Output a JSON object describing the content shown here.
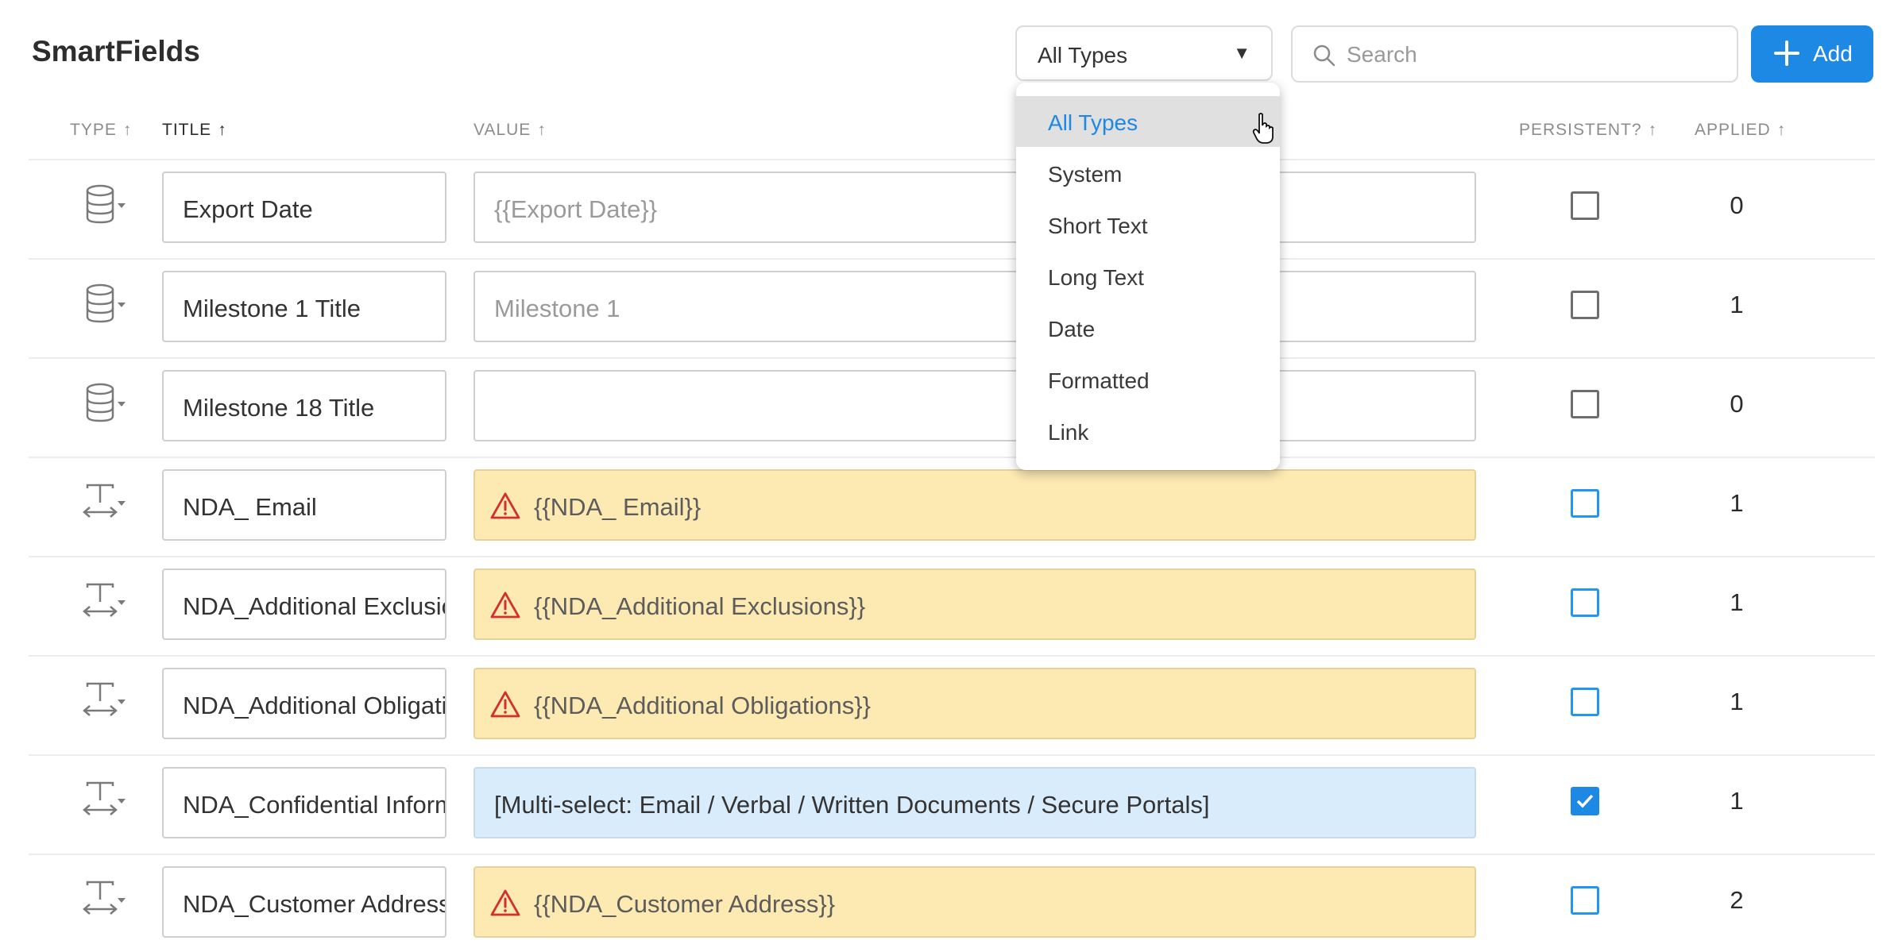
{
  "page": {
    "title": "SmartFields"
  },
  "toolbar": {
    "type_filter": "All Types",
    "search_placeholder": "Search",
    "add_label": "Add"
  },
  "columns": {
    "type": "TYPE",
    "title": "TITLE",
    "value": "VALUE",
    "persistent": "PERSISTENT?",
    "applied": "APPLIED",
    "sort_glyph": "↑"
  },
  "dropdown": {
    "options": [
      "All Types",
      "System",
      "Short Text",
      "Long Text",
      "Date",
      "Formatted",
      "Link"
    ],
    "selected": "All Types"
  },
  "rows": [
    {
      "type": "system-database-icon",
      "title": "Export Date",
      "value": "{{Export Date}}",
      "value_style": "placeholder",
      "persistent": false,
      "checkbox_color": "gray",
      "applied": "0"
    },
    {
      "type": "system-database-icon",
      "title": "Milestone 1 Title",
      "value": "Milestone 1",
      "value_style": "placeholder",
      "persistent": false,
      "checkbox_color": "gray",
      "applied": "1"
    },
    {
      "type": "system-database-icon",
      "title": "Milestone 18 Title",
      "value": "",
      "value_style": "placeholder",
      "persistent": false,
      "checkbox_color": "gray",
      "applied": "0"
    },
    {
      "type": "short-text-icon",
      "title": "NDA_ Email",
      "value": "{{NDA_ Email}}",
      "value_style": "warning",
      "persistent": false,
      "checkbox_color": "blue",
      "applied": "1"
    },
    {
      "type": "short-text-icon",
      "title": "NDA_Additional Exclusions",
      "value": "{{NDA_Additional Exclusions}}",
      "value_style": "warning",
      "persistent": false,
      "checkbox_color": "blue",
      "applied": "1"
    },
    {
      "type": "short-text-icon",
      "title": "NDA_Additional Obligations",
      "value": "{{NDA_Additional Obligations}}",
      "value_style": "warning",
      "persistent": false,
      "checkbox_color": "blue",
      "applied": "1"
    },
    {
      "type": "short-text-icon",
      "title": "NDA_Confidential Information",
      "value": "[Multi-select: Email / Verbal / Written Documents / Secure Portals]",
      "value_style": "info",
      "persistent": true,
      "checkbox_color": "blue",
      "applied": "1"
    },
    {
      "type": "short-text-icon",
      "title": "NDA_Customer Address",
      "value": "{{NDA_Customer Address}}",
      "value_style": "warning",
      "persistent": false,
      "checkbox_color": "blue",
      "applied": "2"
    }
  ],
  "colors": {
    "accent": "#1e88e5",
    "warning_bg": "#fde9b2",
    "info_bg": "#d9ecfb",
    "warning_icon": "#d32f2f"
  }
}
